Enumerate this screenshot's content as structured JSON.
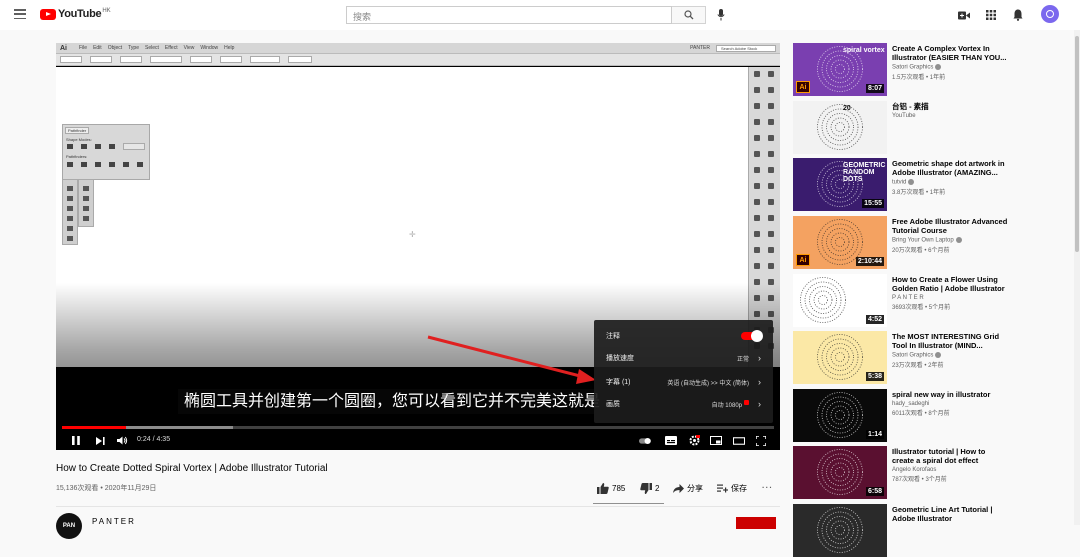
{
  "topbar": {
    "logo_text": "YouTube",
    "region": "HK",
    "search_placeholder": "搜索"
  },
  "player": {
    "ai_menu": [
      "Ai",
      "File",
      "Edit",
      "Object",
      "Type",
      "Select",
      "Effect",
      "View",
      "Window",
      "Help"
    ],
    "ai_panel_title": "Pathfinder",
    "ai_panel_shape_modes": "Shape Modes:",
    "ai_panel_pathfinders": "Pathfinders:",
    "ai_workspace": "PANTER",
    "ai_search": "Search Adobe Stock",
    "subtitle": "椭圆工具并创建第一个圆圈，您可以看到它并不完美",
    "subtitle_tail": "这就是",
    "time": "0:24 / 4:35",
    "progress_played": 0.09,
    "progress_buffered": 0.24,
    "settings": {
      "annotations_label": "注释",
      "annotations_on": true,
      "speed_label": "播放速度",
      "speed_value": "正常",
      "captions_label": "字幕 (1)",
      "captions_value": "英语 (自动生成) >> 中文 (简体)",
      "quality_label": "画质",
      "quality_value": "自动 1080p"
    }
  },
  "video": {
    "title": "How to Create Dotted Spiral Vortex | Adobe Illustrator Tutorial",
    "meta": "15,136次观看 • 2020年11月29日",
    "likes": "785",
    "dislikes": "2",
    "share": "分享",
    "save": "保存",
    "channel": "PANTER",
    "channel_avatar": "PAN"
  },
  "recommendations": [
    {
      "title": "Create A Complex Vortex In Illustrator (EASIER THAN YOU...",
      "channel": "Satori Graphics",
      "verified": true,
      "meta": "1.5万次观看 • 1年前",
      "duration": "8:07",
      "thumb_color": "#7a3fb0",
      "thumb_label": "spiral vortex",
      "ai_badge": true
    },
    {
      "title": "台铝 - 素描",
      "channel": "YouTube",
      "verified": false,
      "meta": "",
      "duration": "",
      "thumb_color": "#f2f2f2",
      "thumb_label": "20",
      "ai_badge": false
    },
    {
      "title": "Geometric shape dot artwork in Adobe Illustrator (AMAZING...",
      "channel": "tutvid",
      "verified": true,
      "meta": "3.8万次观看 • 1年前",
      "duration": "15:55",
      "thumb_color": "#3a1c6e",
      "thumb_label": "GEOMETRIC RANDOM DOTS",
      "ai_badge": false
    },
    {
      "title": "Free Adobe Illustrator Advanced Tutorial Course",
      "channel": "Bring Your Own Laptop",
      "verified": true,
      "meta": "20万次观看 • 6个月前",
      "duration": "2:10:44",
      "thumb_color": "#f4a261",
      "thumb_label": "",
      "ai_badge": true
    },
    {
      "title": "How to Create a Flower Using Golden Ratio | Adobe Illustrator",
      "channel": "P A N T E R",
      "verified": false,
      "meta": "3693次观看 • 5个月前",
      "duration": "4:52",
      "thumb_color": "#ffffff",
      "thumb_label": "",
      "ai_badge": false
    },
    {
      "title": "The MOST INTERESTING Grid Tool In Illustrator (MIND...",
      "channel": "Satori Graphics",
      "verified": true,
      "meta": "23万次观看 • 2年前",
      "duration": "5:38",
      "thumb_color": "#fbe8a6",
      "thumb_label": "",
      "ai_badge": false
    },
    {
      "title": "spiral new way in illustrator",
      "channel": "hady_sadeghi",
      "verified": false,
      "meta": "6011次观看 • 8个月前",
      "duration": "1:14",
      "thumb_color": "#0a0a0a",
      "thumb_label": "",
      "ai_badge": false
    },
    {
      "title": "Illustrator tutorial | How to create a spiral dot effect",
      "channel": "Angelo Korofaos",
      "verified": false,
      "meta": "787次观看 • 3个月前",
      "duration": "6:58",
      "thumb_color": "#5a1030",
      "thumb_label": "",
      "ai_badge": false
    },
    {
      "title": "Geometric Line Art Tutorial | Adobe Illustrator",
      "channel": "",
      "verified": false,
      "meta": "",
      "duration": "",
      "thumb_color": "#2a2a2a",
      "thumb_label": "",
      "ai_badge": false
    }
  ],
  "colors": {
    "brand_red": "#ff0000",
    "arrow": "#e02020"
  },
  "icons": [
    "menu-icon",
    "search-icon",
    "mic-icon",
    "create-video-icon",
    "apps-icon",
    "bell-icon",
    "play-pause-icon",
    "next-icon",
    "volume-icon",
    "subtitles-icon",
    "settings-gear-icon",
    "miniplayer-icon",
    "theater-icon",
    "fullscreen-icon",
    "like-icon",
    "dislike-icon",
    "share-icon",
    "save-icon",
    "more-icon"
  ]
}
